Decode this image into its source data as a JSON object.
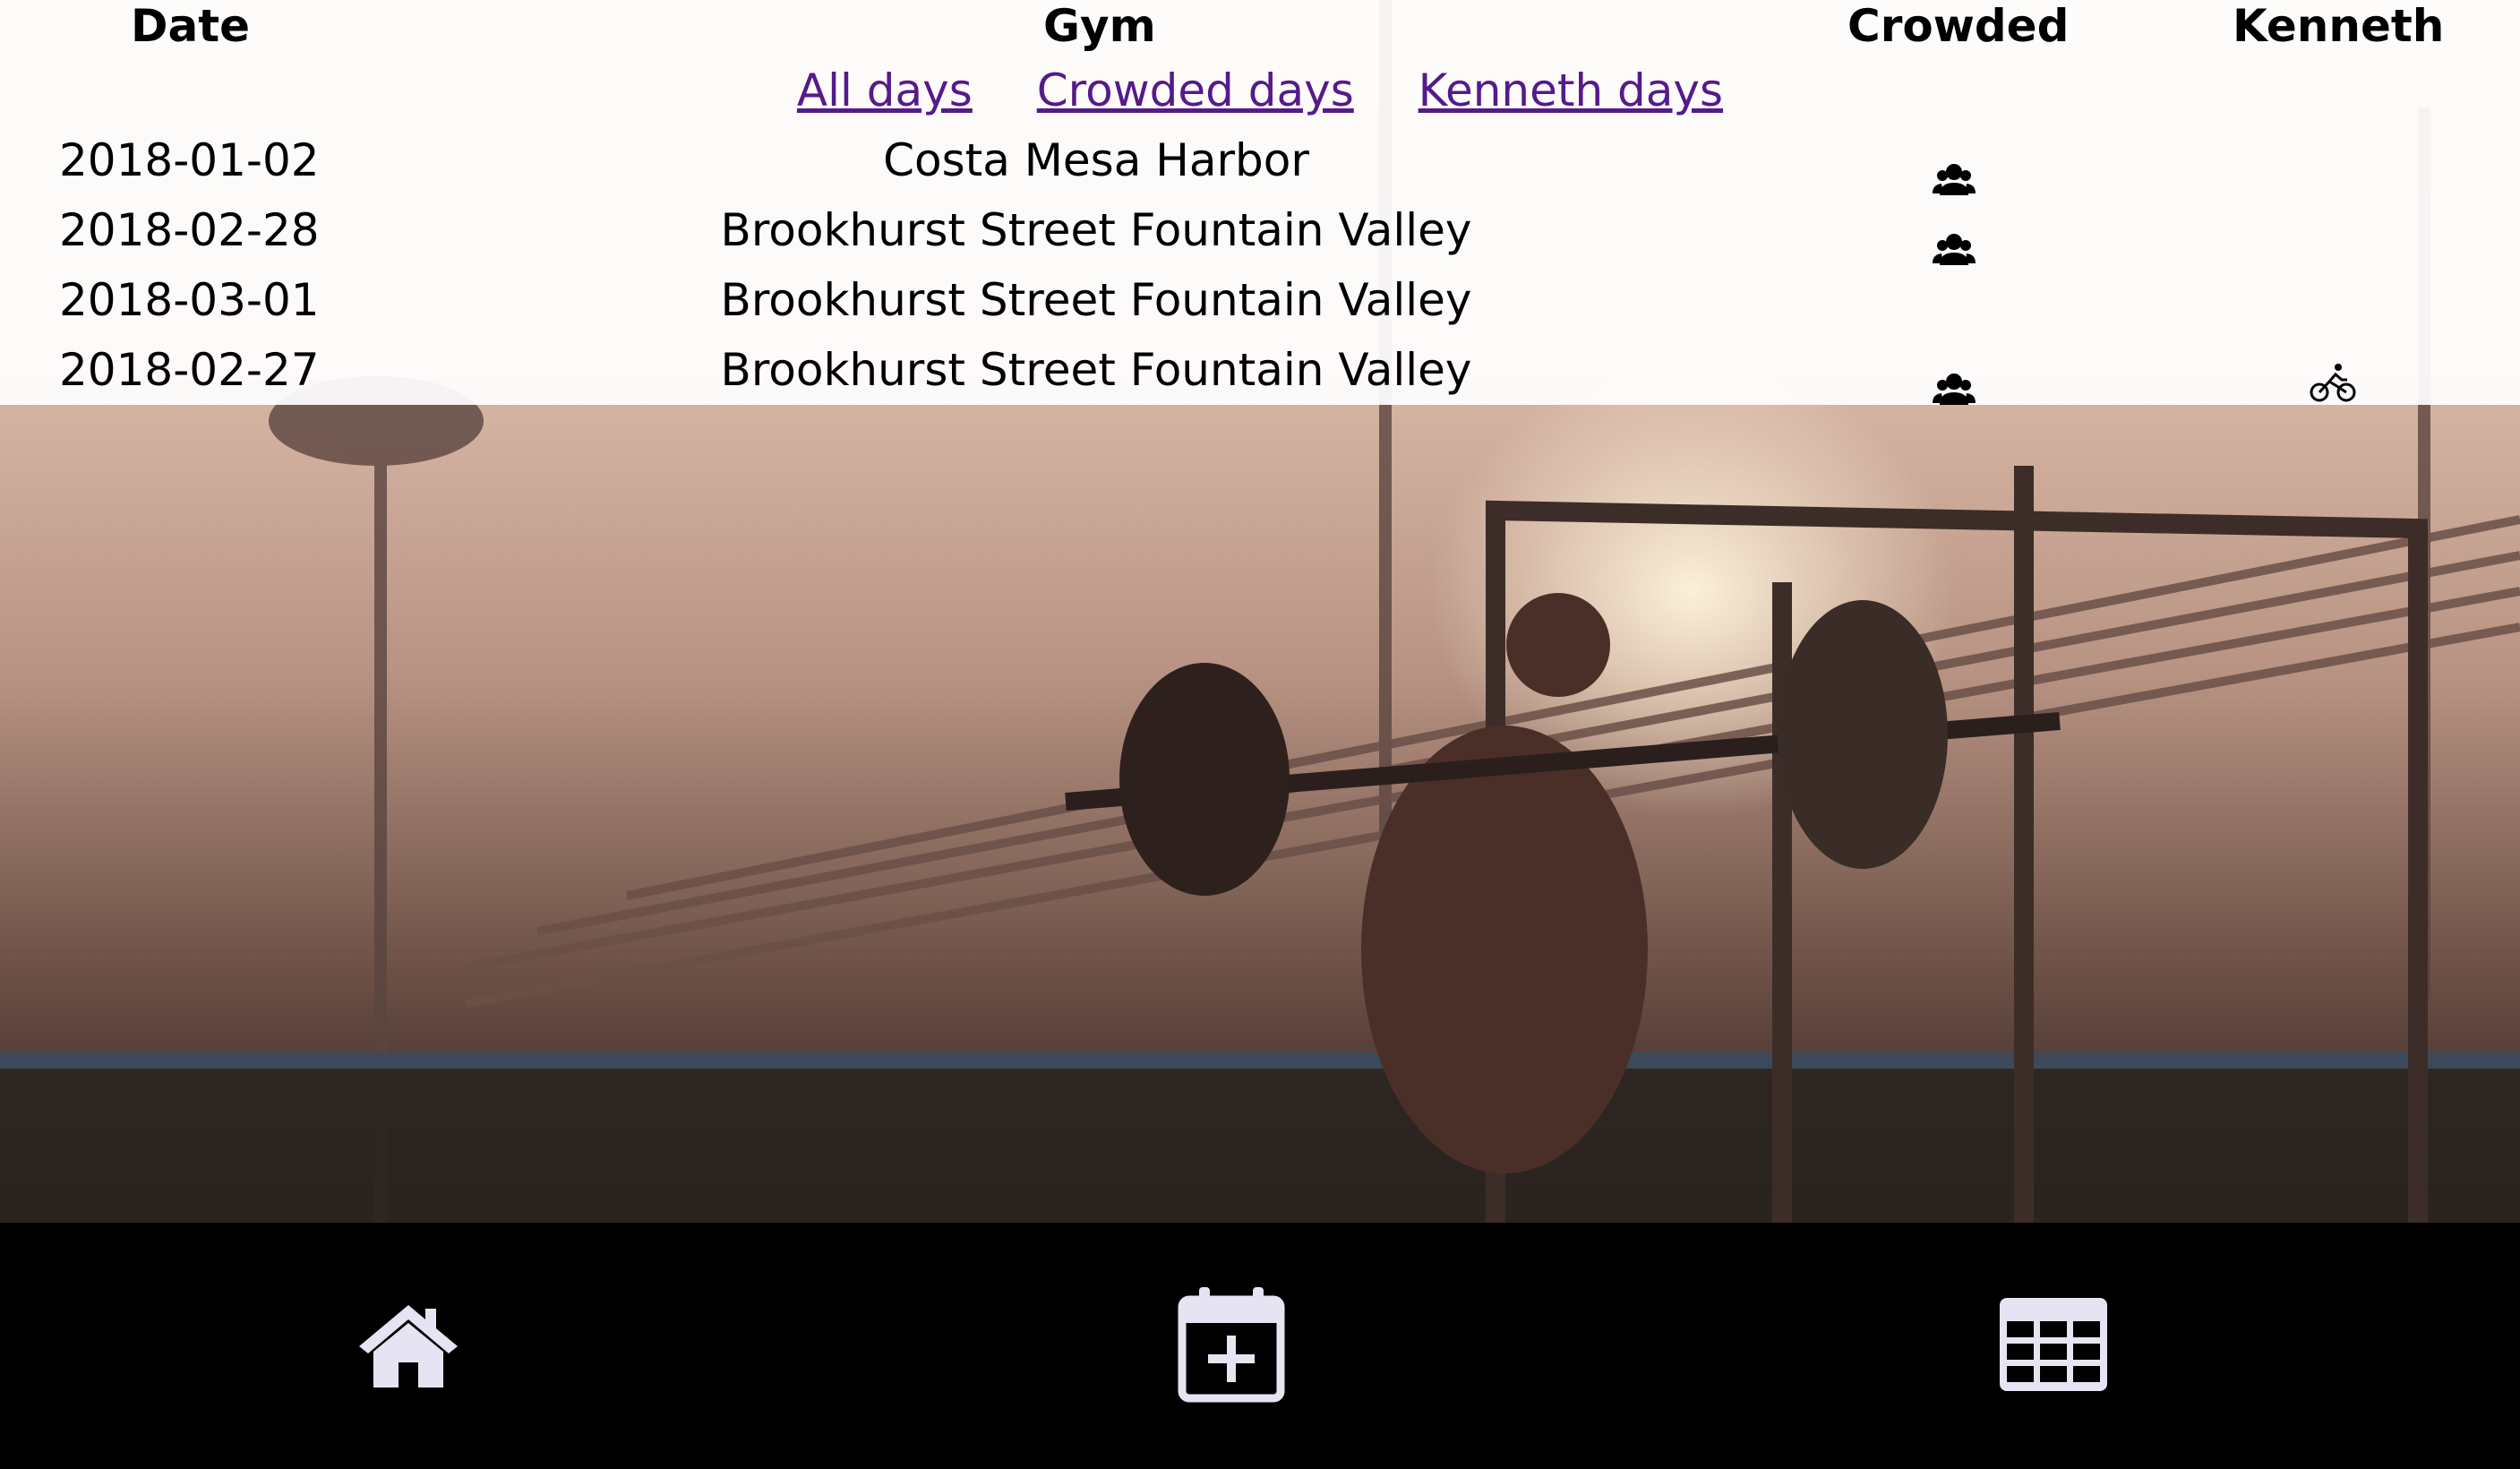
{
  "table": {
    "headers": {
      "date": "Date",
      "gym": "Gym",
      "crowded": "Crowded",
      "kenneth": "Kenneth"
    },
    "filters": [
      "All days",
      "Crowded days",
      "Kenneth days"
    ],
    "rows": [
      {
        "date": "2018-01-02",
        "gym": "Costa Mesa Harbor",
        "crowded": true,
        "kenneth": false
      },
      {
        "date": "2018-02-28",
        "gym": "Brookhurst Street Fountain Valley",
        "crowded": true,
        "kenneth": false
      },
      {
        "date": "2018-03-01",
        "gym": "Brookhurst Street Fountain Valley",
        "crowded": false,
        "kenneth": false
      },
      {
        "date": "2018-02-27",
        "gym": "Brookhurst Street Fountain Valley",
        "crowded": true,
        "kenneth": true
      }
    ],
    "icons": {
      "crowded": "users-icon",
      "kenneth": "bicycle-icon"
    }
  },
  "colors": {
    "link": "#551a8b",
    "nav_bg": "#000000",
    "nav_icon": "#e6e4f2"
  },
  "background": "gym-outdoor-photo",
  "nav": [
    {
      "icon": "home-icon"
    },
    {
      "icon": "calendar-plus-icon"
    },
    {
      "icon": "grid-icon"
    }
  ]
}
